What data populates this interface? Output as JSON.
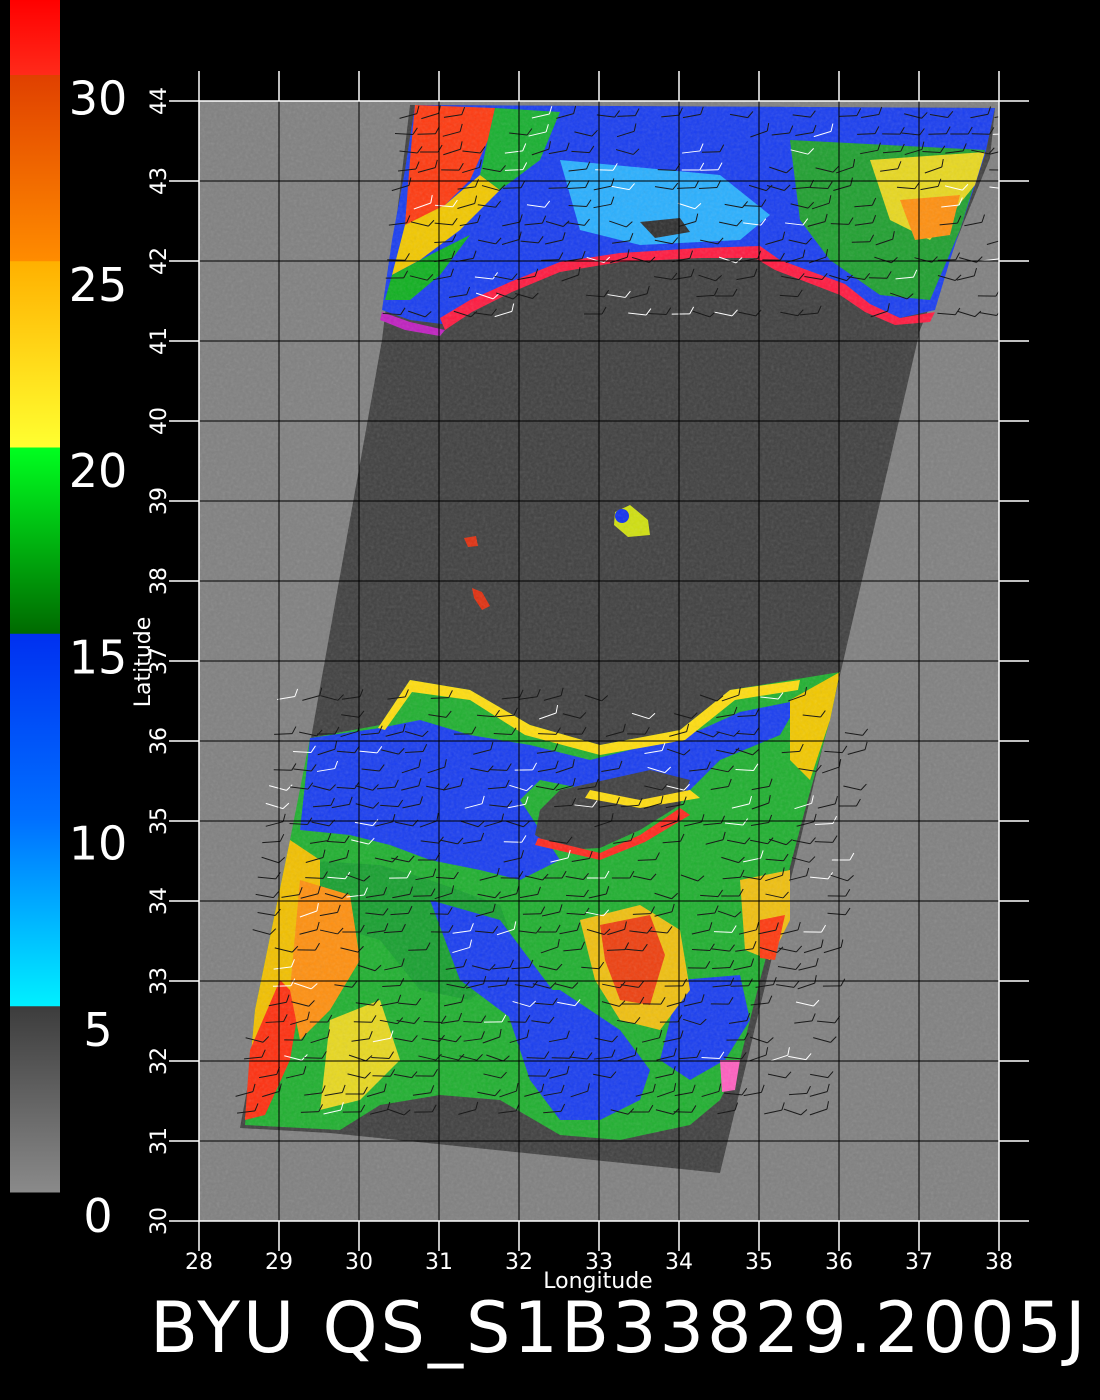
{
  "title": "BYU QS_S1B33829.2005J",
  "map": {
    "x_label": "Longitude",
    "y_label": "Latitude",
    "lon_range": [
      28,
      38
    ],
    "lat_range": [
      30,
      44
    ],
    "x_ticks": [
      "28",
      "29",
      "30",
      "31",
      "32",
      "33",
      "34",
      "35",
      "36",
      "37",
      "38"
    ],
    "y_ticks": [
      "30",
      "31",
      "32",
      "33",
      "34",
      "35",
      "36",
      "37",
      "38",
      "39",
      "40",
      "41",
      "42",
      "43",
      "44"
    ],
    "grid": true
  },
  "colorbar": {
    "labels": [
      "0",
      "5",
      "10",
      "15",
      "20",
      "25",
      "30"
    ],
    "range": [
      0,
      32
    ],
    "bands": [
      {
        "from": 0,
        "to": 5,
        "colors": [
          "#8a8a8a",
          "#3c3c3c"
        ]
      },
      {
        "from": 5,
        "to": 10,
        "colors": [
          "#00f0ff",
          "#0070ff"
        ]
      },
      {
        "from": 10,
        "to": 15,
        "colors": [
          "#0070ff",
          "#0030f0"
        ]
      },
      {
        "from": 15,
        "to": 20,
        "colors": [
          "#006a00",
          "#00ff20"
        ]
      },
      {
        "from": 20,
        "to": 25,
        "colors": [
          "#ffff30",
          "#ffb000"
        ]
      },
      {
        "from": 25,
        "to": 30,
        "colors": [
          "#ff8c00",
          "#e04000"
        ]
      },
      {
        "from": 30,
        "to": 32,
        "colors": [
          "#ff2a1a",
          "#ff0000"
        ]
      }
    ]
  },
  "colors": {
    "background": "#000000",
    "plot_area": "#808080",
    "no_data_swath": "#404040",
    "wind_barbs_dark": "#1a1a1a",
    "wind_barbs_light": "#ffffff"
  }
}
